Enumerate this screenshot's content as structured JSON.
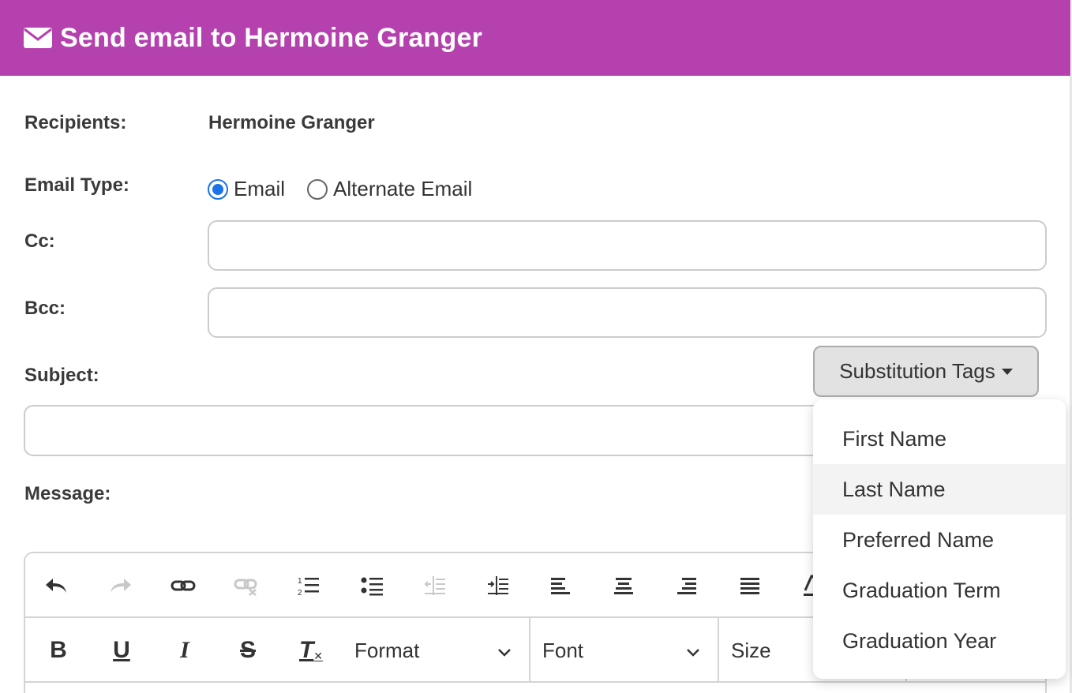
{
  "header": {
    "title": "Send email to Hermoine Granger",
    "icon": "envelope-icon",
    "color": "#b541ae"
  },
  "recipients": {
    "label": "Recipients:",
    "value": "Hermoine Granger"
  },
  "email_type": {
    "label": "Email Type:",
    "options": [
      {
        "label": "Email",
        "checked": true
      },
      {
        "label": "Alternate Email",
        "checked": false
      }
    ],
    "accent": "#1a73e8"
  },
  "cc": {
    "label": "Cc:",
    "value": ""
  },
  "bcc": {
    "label": "Bcc:",
    "value": ""
  },
  "subject": {
    "label": "Subject:",
    "value": ""
  },
  "substitution": {
    "button_label": "Substitution Tags",
    "items": [
      "First Name",
      "Last Name",
      "Preferred Name",
      "Graduation Term",
      "Graduation Year"
    ],
    "highlighted": "Last Name"
  },
  "message": {
    "label": "Message:"
  },
  "editor": {
    "toolbar1_icons": [
      "undo-icon",
      "redo-icon",
      "link-icon",
      "unlink-icon",
      "numbered-list-icon",
      "bulleted-list-icon",
      "decrease-indent-icon",
      "increase-indent-icon",
      "align-left-icon",
      "align-center-icon",
      "align-right-icon",
      "justify-icon",
      "text-color-icon"
    ],
    "format_buttons": {
      "bold": "B",
      "underline": "U",
      "italic": "I",
      "strike": "S",
      "clear": "T"
    },
    "format_select": "Format",
    "font_select": "Font",
    "size_select": "Size"
  }
}
